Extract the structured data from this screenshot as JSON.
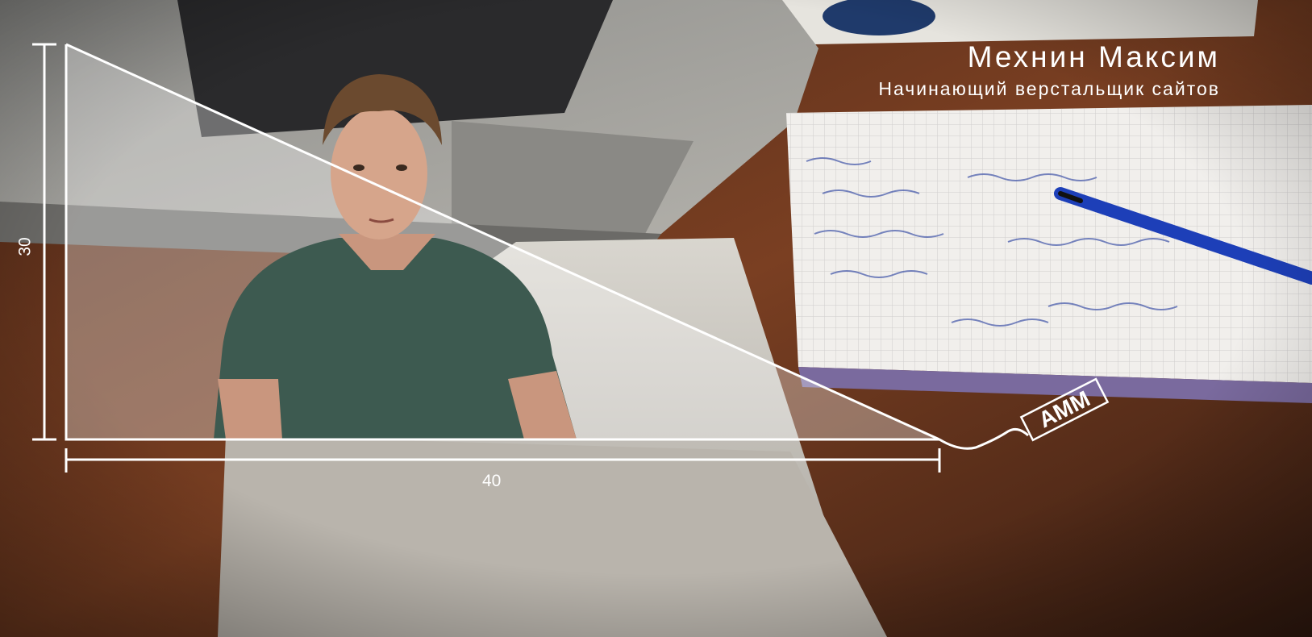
{
  "header": {
    "name": "Мехнин Максим",
    "subtitle": "Начинающий верстальщик сайтов"
  },
  "dimensions": {
    "height_label": "30",
    "width_label": "40"
  },
  "logo": {
    "text": "АММ"
  },
  "colors": {
    "desk": "#5a2f1c",
    "overlay_white": "#ffffff",
    "shirt": "#3d5a50"
  }
}
